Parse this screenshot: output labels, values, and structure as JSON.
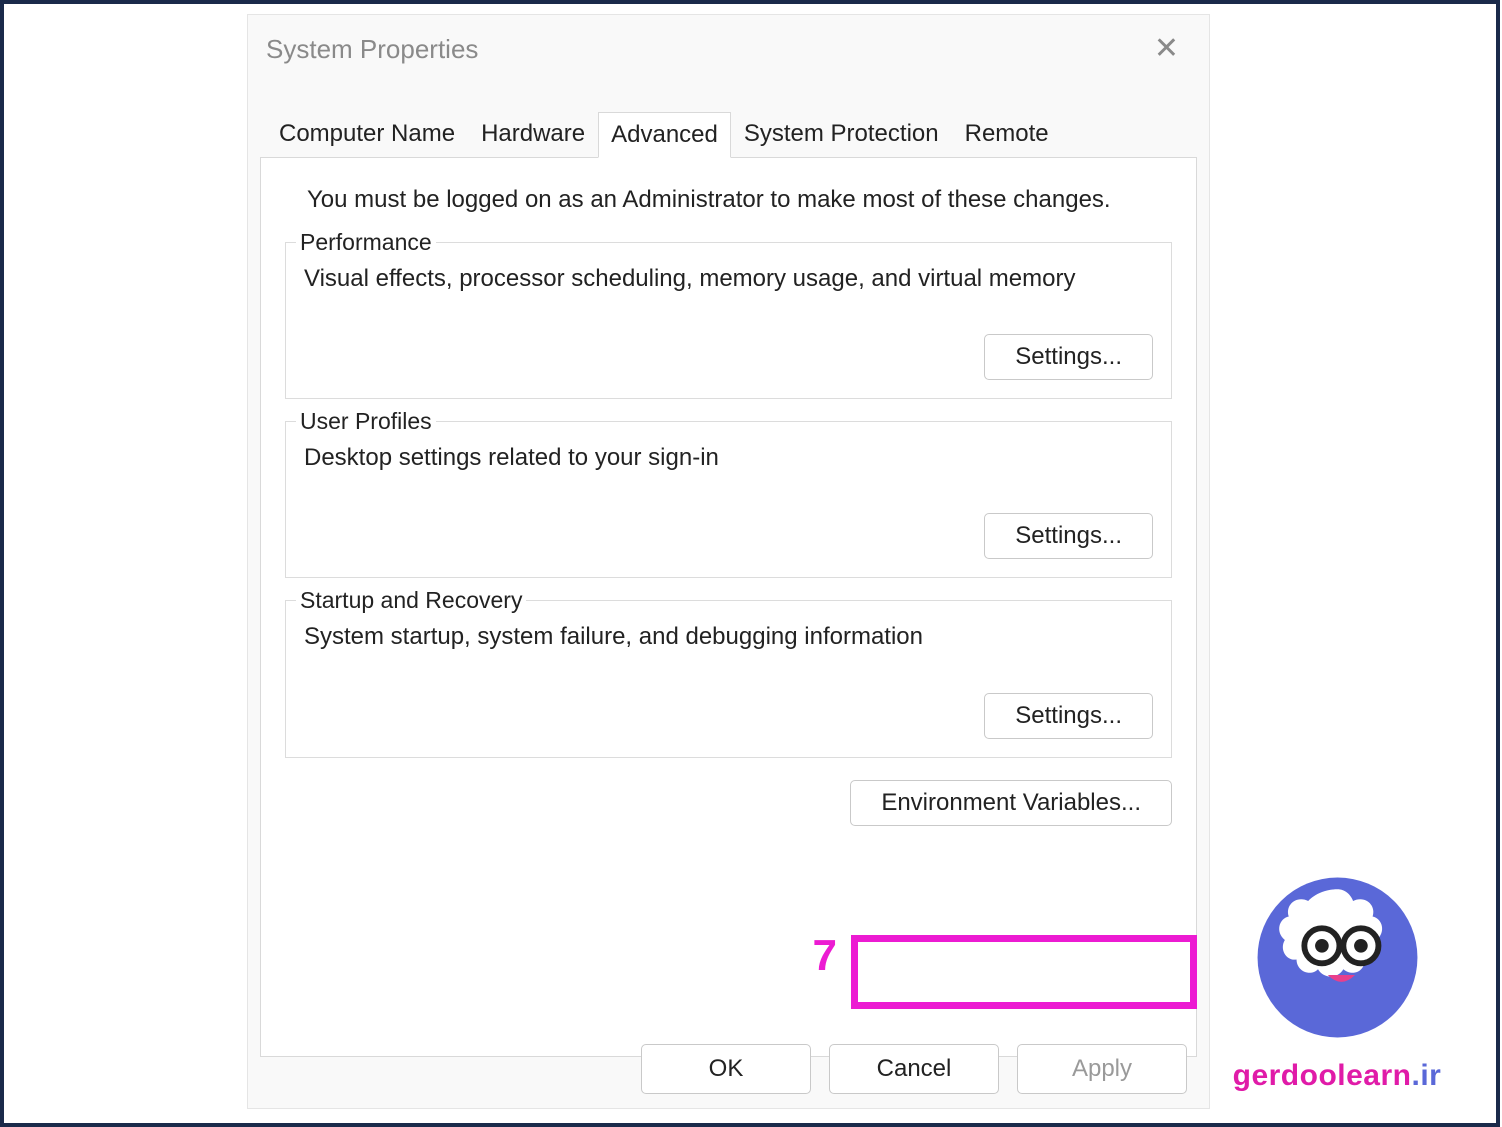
{
  "dialog": {
    "title": "System Properties",
    "tabs": [
      "Computer Name",
      "Hardware",
      "Advanced",
      "System Protection",
      "Remote"
    ],
    "active_tab_index": 2,
    "admin_note": "You must be logged on as an Administrator to make most of these changes.",
    "groups": {
      "performance": {
        "legend": "Performance",
        "desc": "Visual effects, processor scheduling, memory usage, and virtual memory",
        "button": "Settings..."
      },
      "user_profiles": {
        "legend": "User Profiles",
        "desc": "Desktop settings related to your sign-in",
        "button": "Settings..."
      },
      "startup": {
        "legend": "Startup and Recovery",
        "desc": "System startup, system failure, and debugging information",
        "button": "Settings..."
      }
    },
    "env_button": "Environment Variables...",
    "buttons": {
      "ok": "OK",
      "cancel": "Cancel",
      "apply": "Apply"
    }
  },
  "annotation": {
    "number": "7"
  },
  "watermark": {
    "text_left": "gerdoolearn",
    "text_right": "ir"
  }
}
